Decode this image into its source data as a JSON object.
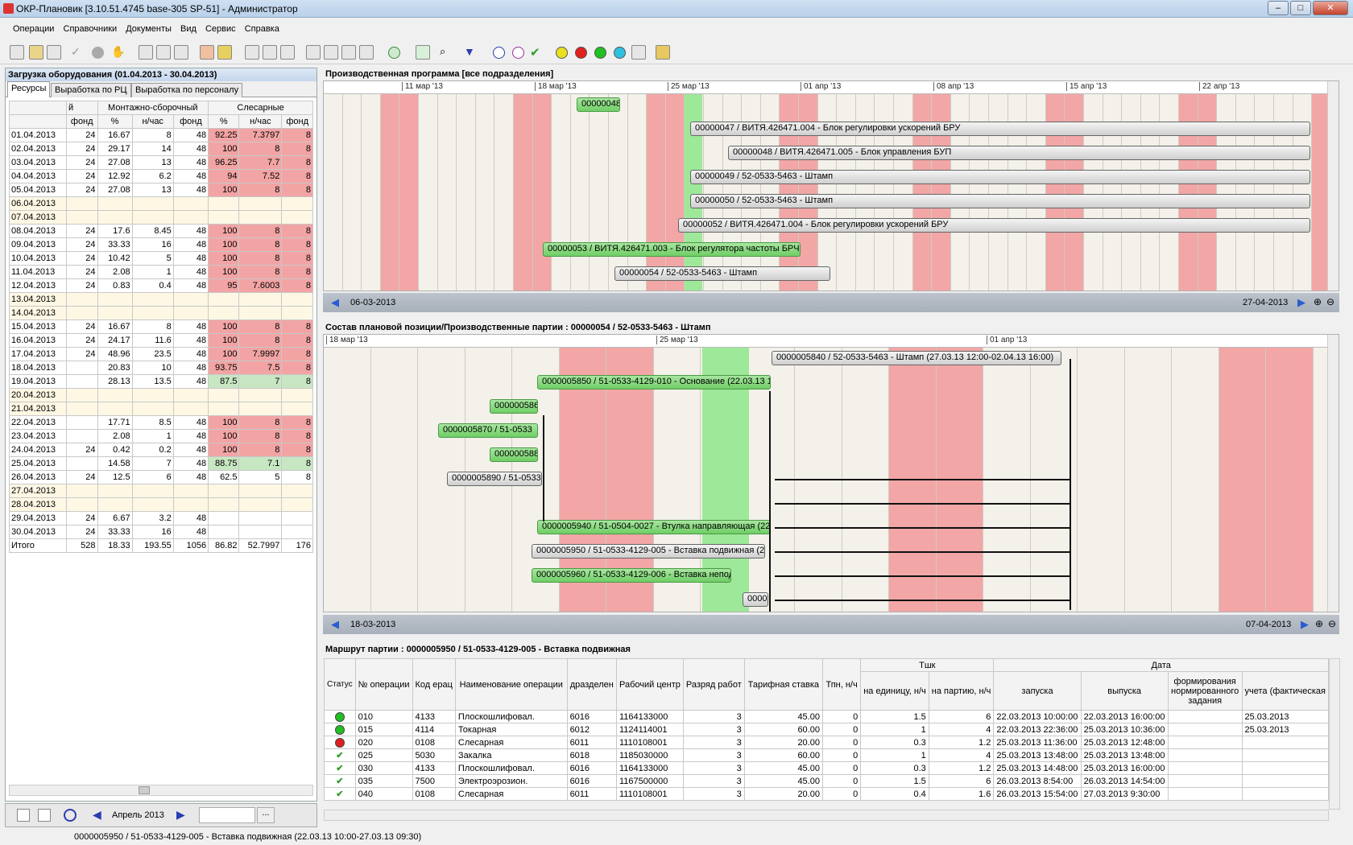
{
  "window": {
    "title": "ОКР-Плановик [3.10.51.4745 base-305 SP-51] - Администратор"
  },
  "menu": [
    "Операции",
    "Справочники",
    "Документы",
    "Вид",
    "Сервис",
    "Справка"
  ],
  "left": {
    "title": "Загрузка оборудования (01.04.2013 - 30.04.2013)",
    "tabs": [
      "Ресурсы",
      "Выработка по РЦ",
      "Выработка по персоналу"
    ],
    "group_headers": [
      "й",
      "Монтажно-сборочный",
      "Слесарные"
    ],
    "col_headers": [
      "фонд",
      "%",
      "н/час",
      "фонд",
      "%",
      "н/час",
      "фонд"
    ],
    "rows": [
      {
        "d": "01.04.2013",
        "c": [
          "24",
          "16.67",
          "8",
          "48",
          "92.25",
          "7.3797",
          "8"
        ],
        "hl": "red"
      },
      {
        "d": "02.04.2013",
        "c": [
          "24",
          "29.17",
          "14",
          "48",
          "100",
          "8",
          "8"
        ],
        "hl": "red"
      },
      {
        "d": "03.04.2013",
        "c": [
          "24",
          "27.08",
          "13",
          "48",
          "96.25",
          "7.7",
          "8"
        ],
        "hl": "red"
      },
      {
        "d": "04.04.2013",
        "c": [
          "24",
          "12.92",
          "6.2",
          "48",
          "94",
          "7.52",
          "8"
        ],
        "hl": "red"
      },
      {
        "d": "05.04.2013",
        "c": [
          "24",
          "27.08",
          "13",
          "48",
          "100",
          "8",
          "8"
        ],
        "hl": "red"
      },
      {
        "d": "06.04.2013",
        "c": [
          "",
          "",
          "",
          "",
          "",
          "",
          ""
        ],
        "hl": "we"
      },
      {
        "d": "07.04.2013",
        "c": [
          "",
          "",
          "",
          "",
          "",
          "",
          ""
        ],
        "hl": "we"
      },
      {
        "d": "08.04.2013",
        "c": [
          "24",
          "17.6",
          "8.45",
          "48",
          "100",
          "8",
          "8"
        ],
        "hl": "red"
      },
      {
        "d": "09.04.2013",
        "c": [
          "24",
          "33.33",
          "16",
          "48",
          "100",
          "8",
          "8"
        ],
        "hl": "red"
      },
      {
        "d": "10.04.2013",
        "c": [
          "24",
          "10.42",
          "5",
          "48",
          "100",
          "8",
          "8"
        ],
        "hl": "red"
      },
      {
        "d": "11.04.2013",
        "c": [
          "24",
          "2.08",
          "1",
          "48",
          "100",
          "8",
          "8"
        ],
        "hl": "red"
      },
      {
        "d": "12.04.2013",
        "c": [
          "24",
          "0.83",
          "0.4",
          "48",
          "95",
          "7.6003",
          "8"
        ],
        "hl": "red"
      },
      {
        "d": "13.04.2013",
        "c": [
          "",
          "",
          "",
          "",
          "",
          "",
          ""
        ],
        "hl": "we"
      },
      {
        "d": "14.04.2013",
        "c": [
          "",
          "",
          "",
          "",
          "",
          "",
          ""
        ],
        "hl": "we"
      },
      {
        "d": "15.04.2013",
        "c": [
          "24",
          "16.67",
          "8",
          "48",
          "100",
          "8",
          "8"
        ],
        "hl": "red"
      },
      {
        "d": "16.04.2013",
        "c": [
          "24",
          "24.17",
          "11.6",
          "48",
          "100",
          "8",
          "8"
        ],
        "hl": "red"
      },
      {
        "d": "17.04.2013",
        "c": [
          "24",
          "48.96",
          "23.5",
          "48",
          "100",
          "7.9997",
          "8"
        ],
        "hl": "red"
      },
      {
        "d": "18.04.2013",
        "c": [
          "",
          "20.83",
          "10",
          "48",
          "93.75",
          "7.5",
          "8"
        ],
        "hl": "red"
      },
      {
        "d": "19.04.2013",
        "c": [
          "",
          "28.13",
          "13.5",
          "48",
          "87.5",
          "7",
          "8"
        ],
        "hl": "grn"
      },
      {
        "d": "20.04.2013",
        "c": [
          "",
          "",
          "",
          "",
          "",
          "",
          ""
        ],
        "hl": "we"
      },
      {
        "d": "21.04.2013",
        "c": [
          "",
          "",
          "",
          "",
          "",
          "",
          ""
        ],
        "hl": "we"
      },
      {
        "d": "22.04.2013",
        "c": [
          "",
          "17.71",
          "8.5",
          "48",
          "100",
          "8",
          "8"
        ],
        "hl": "red"
      },
      {
        "d": "23.04.2013",
        "c": [
          "",
          "2.08",
          "1",
          "48",
          "100",
          "8",
          "8"
        ],
        "hl": "red"
      },
      {
        "d": "24.04.2013",
        "c": [
          "24",
          "0.42",
          "0.2",
          "48",
          "100",
          "8",
          "8"
        ],
        "hl": "red"
      },
      {
        "d": "25.04.2013",
        "c": [
          "",
          "14.58",
          "7",
          "48",
          "88.75",
          "7.1",
          "8"
        ],
        "hl": "grn"
      },
      {
        "d": "26.04.2013",
        "c": [
          "24",
          "12.5",
          "6",
          "48",
          "62.5",
          "5",
          "8"
        ],
        "hl": "none"
      },
      {
        "d": "27.04.2013",
        "c": [
          "",
          "",
          "",
          "",
          "",
          "",
          ""
        ],
        "hl": "we"
      },
      {
        "d": "28.04.2013",
        "c": [
          "",
          "",
          "",
          "",
          "",
          "",
          ""
        ],
        "hl": "we"
      },
      {
        "d": "29.04.2013",
        "c": [
          "24",
          "6.67",
          "3.2",
          "48",
          "",
          "",
          ""
        ],
        "hl": "none"
      },
      {
        "d": "30.04.2013",
        "c": [
          "24",
          "33.33",
          "16",
          "48",
          "",
          "",
          ""
        ],
        "hl": "none"
      },
      {
        "d": "Итого",
        "c": [
          "528",
          "18.33",
          "193.55",
          "1056",
          "86.82",
          "52.7997",
          "176"
        ],
        "hl": "none"
      }
    ],
    "month": "Апрель 2013"
  },
  "prog": {
    "title": "Производственная программа  [все подразделения]",
    "dates": [
      "11 мар '13",
      "18 мар '13",
      "25 мар '13",
      "01 апр '13",
      "08 апр '13",
      "15 апр '13",
      "22 апр '13"
    ],
    "bars": [
      "00000048",
      "00000047 / ВИТЯ.426471.004 - Блок регулировки ускорений БРУ",
      "00000048 / ВИТЯ.426471.005 - Блок управления БУП",
      "00000049 / 52-0533-5463 - Штамп",
      "00000050 / 52-0533-5463 - Штамп",
      "00000052 / ВИТЯ.426471.004 - Блок регулировки ускорений БРУ",
      "00000053 / ВИТЯ.426471.003 - Блок регулятора частоты БРЧ",
      "00000054 / 52-0533-5463 - Штамп"
    ],
    "nav_left": "06-03-2013",
    "nav_right": "27-04-2013"
  },
  "comp": {
    "title": "Состав плановой позиции/Производственные партии : 00000054 / 52-0533-5463 - Штамп",
    "dates": [
      "18 мар '13",
      "25 мар '13",
      "01 апр '13"
    ],
    "bars": [
      "0000005840 / 52-0533-5463 - Штамп (27.03.13 12:00-02.04.13 16:00)",
      "0000005850 / 51-0533-4129-010 - Основание (22.03.13 12",
      "000000586",
      "0000005870 / 51-0533",
      "000000588",
      "0000005890 / 51-0533",
      "0000005940 / 51-0504-0027 - Втулка направляющая (22",
      "0000005950 / 51-0533-4129-005 - Вставка подвижная (22",
      "0000005960 / 51-0533-4129-006 - Вставка непод",
      "0000("
    ],
    "nav_left": "18-03-2013",
    "nav_right": "07-04-2013"
  },
  "route": {
    "title": "Маршрут партии : 0000005950 / 51-0533-4129-005 - Вставка подвижная",
    "headers": [
      "Статус",
      "№ операции",
      "Код ерац",
      "Наименование операции",
      "дразделен",
      "Рабочий центр",
      "Разряд работ",
      "Тарифная ставка",
      "Тпн, н/ч",
      "на единицу, н/ч",
      "на партию, н/ч",
      "запуска",
      "выпуска",
      "формирования нормированного задания",
      "учета (фактическая"
    ],
    "group_tsh": "Тшк",
    "group_date": "Дата",
    "rows": [
      {
        "st": "green",
        "c": [
          "010",
          "4133",
          "Плоскошлифовал.",
          "6016",
          "1164133000",
          "3",
          "45.00",
          "0",
          "1.5",
          "6",
          "22.03.2013 10:00:00",
          "22.03.2013 16:00:00",
          "",
          "25.03.2013"
        ]
      },
      {
        "st": "green",
        "c": [
          "015",
          "4114",
          "Токарная",
          "6012",
          "1124114001",
          "3",
          "60.00",
          "0",
          "1",
          "4",
          "22.03.2013 22:36:00",
          "25.03.2013 10:36:00",
          "",
          "25.03.2013"
        ]
      },
      {
        "st": "red",
        "c": [
          "020",
          "0108",
          "Слесарная",
          "6011",
          "1110108001",
          "3",
          "20.00",
          "0",
          "0.3",
          "1.2",
          "25.03.2013 11:36:00",
          "25.03.2013 12:48:00",
          "",
          ""
        ]
      },
      {
        "st": "check",
        "c": [
          "025",
          "5030",
          "Закалка",
          "6018",
          "1185030000",
          "3",
          "60.00",
          "0",
          "1",
          "4",
          "25.03.2013 13:48:00",
          "25.03.2013 13:48:00",
          "",
          ""
        ]
      },
      {
        "st": "check",
        "c": [
          "030",
          "4133",
          "Плоскошлифовал.",
          "6016",
          "1164133000",
          "3",
          "45.00",
          "0",
          "0.3",
          "1.2",
          "25.03.2013 14:48:00",
          "25.03.2013 16:00:00",
          "",
          ""
        ]
      },
      {
        "st": "check",
        "c": [
          "035",
          "7500",
          "Электроэрозион.",
          "6016",
          "1167500000",
          "3",
          "45.00",
          "0",
          "1.5",
          "6",
          "26.03.2013 8:54:00",
          "26.03.2013 14:54:00",
          "",
          ""
        ]
      },
      {
        "st": "check",
        "c": [
          "040",
          "0108",
          "Слесарная",
          "6011",
          "1110108001",
          "3",
          "20.00",
          "0",
          "0.4",
          "1.6",
          "26.03.2013 15:54:00",
          "27.03.2013 9:30:00",
          "",
          ""
        ]
      }
    ]
  },
  "status": "0000005950 / 51-0533-4129-005 - Вставка подвижная (22.03.13 10:00-27.03.13 09:30)"
}
